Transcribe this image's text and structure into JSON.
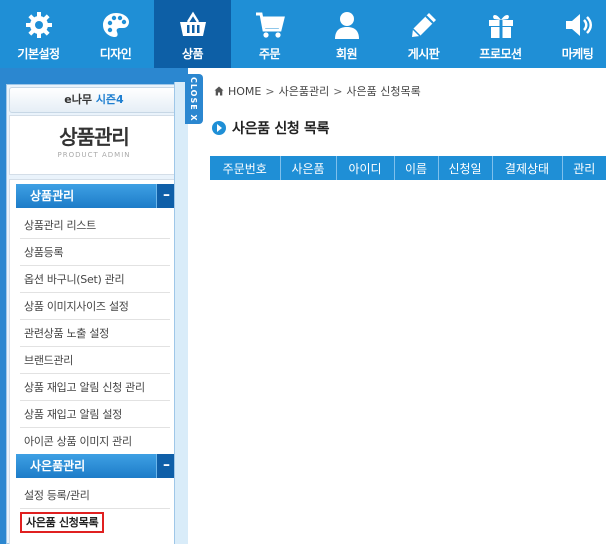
{
  "nav": {
    "items": [
      {
        "label": "기본설정",
        "icon": "gear-icon",
        "active": false
      },
      {
        "label": "디자인",
        "icon": "palette-icon",
        "active": false
      },
      {
        "label": "상품",
        "icon": "basket-icon",
        "active": true
      },
      {
        "label": "주문",
        "icon": "cart-icon",
        "active": false
      },
      {
        "label": "회원",
        "icon": "person-icon",
        "active": false
      },
      {
        "label": "게시판",
        "icon": "pencil-icon",
        "active": false
      },
      {
        "label": "프로모션",
        "icon": "gift-icon",
        "active": false
      },
      {
        "label": "마케팅",
        "icon": "speaker-icon",
        "active": false
      }
    ],
    "colors": {
      "bar": "#1f8fd6",
      "active": "#0d5fa6"
    }
  },
  "sidebar": {
    "brand_prefix": "e나무",
    "brand_highlight": "시즌4",
    "title": "상품관리",
    "subtitle": "PRODUCT ADMIN",
    "close_label": "CLOSE X",
    "sections": [
      {
        "title": "상품관리",
        "toggle": "–",
        "items": [
          "상품관리 리스트",
          "상품등록",
          "옵션 바구니(Set) 관리",
          "상품 이미지사이즈 설정",
          "관련상품 노출 설정",
          "브랜드관리",
          "상품 재입고 알림 신청 관리",
          "상품 재입고 알림 설정",
          "아이콘 상품 이미지 관리"
        ]
      },
      {
        "title": "사은품관리",
        "toggle": "–",
        "items": [
          "설정 등록/관리",
          "사은품 신청목록"
        ],
        "current_index": 1
      }
    ]
  },
  "breadcrumb": {
    "home": "HOME",
    "sep": ">",
    "level1": "사은품관리",
    "level2": "사은품 신청목록"
  },
  "page": {
    "title": "사은품 신청 목록"
  },
  "table": {
    "columns": [
      "주문번호",
      "사은품",
      "아이디",
      "이름",
      "신청일",
      "결제상태",
      "관리"
    ]
  }
}
